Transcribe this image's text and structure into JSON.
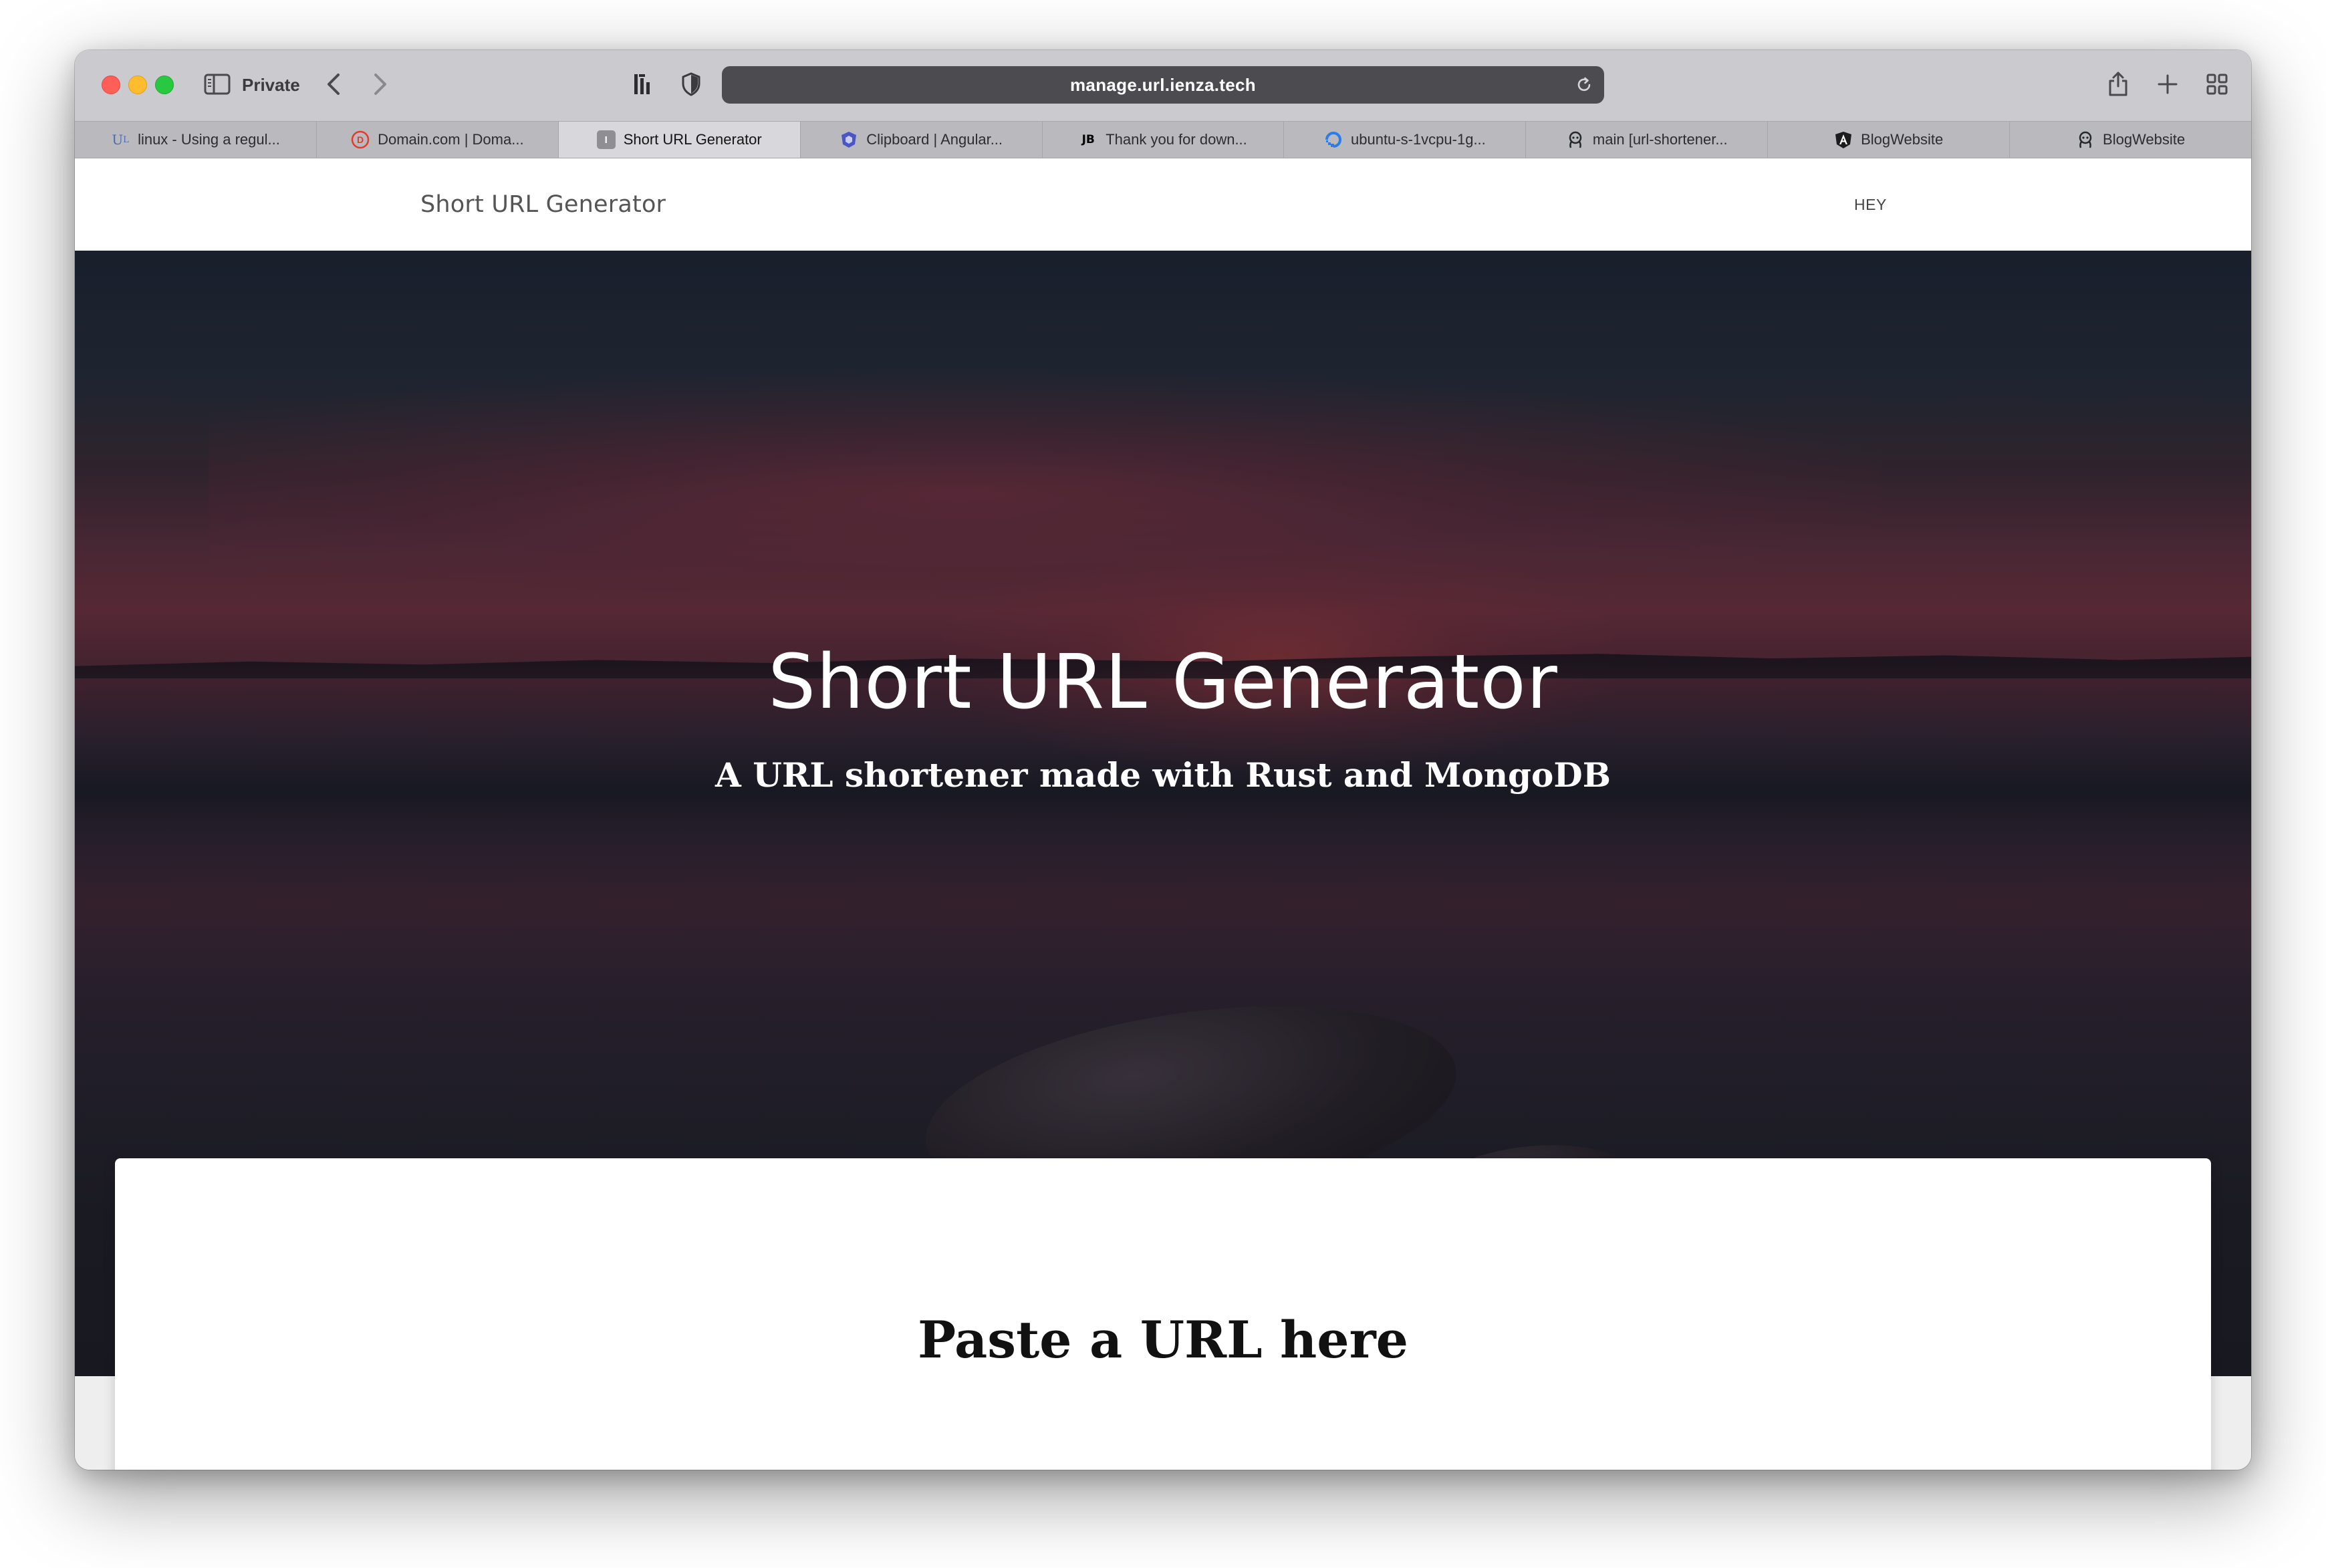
{
  "browser": {
    "private_label": "Private",
    "address": "manage.url.ienza.tech",
    "tabs": [
      {
        "title": "linux - Using a regul...",
        "favicon_icon": "unix-linux-icon",
        "favicon_text": "U L",
        "favicon_color": "#4a6cb3",
        "active": false
      },
      {
        "title": "Domain.com | Doma...",
        "favicon_icon": "domain-com-icon",
        "favicon_text": "D",
        "favicon_color": "#e23b2e",
        "active": false
      },
      {
        "title": "Short URL Generator",
        "favicon_icon": "site-letter-icon",
        "favicon_text": "I",
        "favicon_color": "#8e8e93",
        "active": true
      },
      {
        "title": "Clipboard | Angular...",
        "favicon_icon": "angular-shield-icon",
        "favicon_text": "",
        "favicon_color": "#4a56c8",
        "active": false
      },
      {
        "title": "Thank you for down...",
        "favicon_icon": "jetbrains-icon",
        "favicon_text": "JB",
        "favicon_color": "#000000",
        "active": false
      },
      {
        "title": "ubuntu-s-1vcpu-1g...",
        "favicon_icon": "digitalocean-icon",
        "favicon_text": "",
        "favicon_color": "#2b7de9",
        "active": false
      },
      {
        "title": "main [url-shortener...",
        "favicon_icon": "github-octocat-icon",
        "favicon_text": "",
        "favicon_color": "#24292e",
        "active": false
      },
      {
        "title": "BlogWebsite",
        "favicon_icon": "angular-a-icon",
        "favicon_text": "A",
        "favicon_color": "#1c1c1e",
        "active": false
      },
      {
        "title": "BlogWebsite",
        "favicon_icon": "github-octocat-icon",
        "favicon_text": "",
        "favicon_color": "#24292e",
        "active": false
      }
    ]
  },
  "site": {
    "brand": "Short URL Generator",
    "nav_link": "HEY"
  },
  "hero": {
    "title": "Short URL Generator",
    "subtitle": "A URL shortener made with Rust and MongoDB"
  },
  "card": {
    "heading": "Paste a URL here"
  },
  "colors": {
    "toolbar_bg": "#cbcbcf",
    "tabstrip_bg": "#b9b9be",
    "active_tab_bg": "#d8d8dc",
    "addressbar_bg": "#4c4c50",
    "hero_overlay": "#1b2431"
  }
}
